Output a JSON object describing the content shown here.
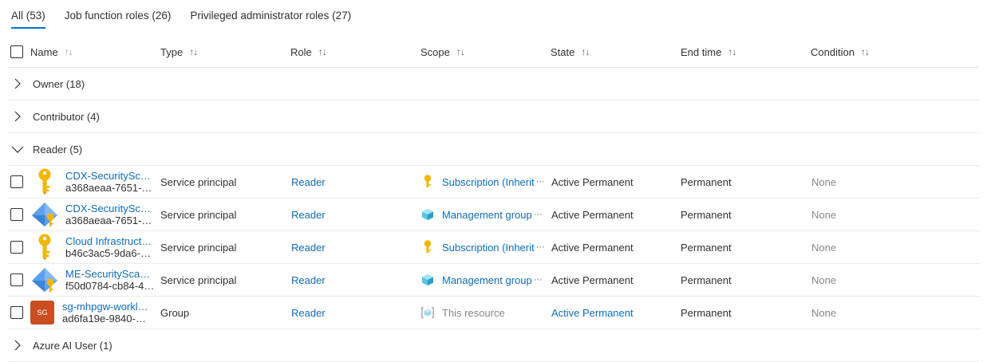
{
  "tabs": [
    {
      "label": "All (53)",
      "active": true
    },
    {
      "label": "Job function roles (26)",
      "active": false
    },
    {
      "label": "Privileged administrator roles (27)",
      "active": false
    }
  ],
  "columns": {
    "name": "Name",
    "type": "Type",
    "role": "Role",
    "scope": "Scope",
    "state": "State",
    "end_time": "End time",
    "condition": "Condition"
  },
  "groups": {
    "owner": "Owner (18)",
    "contributor": "Contributor (4)",
    "reader": "Reader (5)",
    "azure_ai_user": "Azure AI User (1)"
  },
  "rows": [
    {
      "icon": "key-icon",
      "name": "CDX-SecuritySca…",
      "id": "a368aeaa-7651-…",
      "type": "Service principal",
      "role": "Reader",
      "scope_icon": "key-icon",
      "scope": "Subscription (Inherit",
      "state": "Active Permanent",
      "end_time": "Permanent",
      "condition": "None"
    },
    {
      "icon": "managed-identity-icon",
      "name": "CDX-SecuritySca…",
      "id": "a368aeaa-7651-…",
      "type": "Service principal",
      "role": "Reader",
      "scope_icon": "cube-icon",
      "scope": "Management group",
      "state": "Active Permanent",
      "end_time": "Permanent",
      "condition": "None"
    },
    {
      "icon": "key-icon",
      "name": "Cloud Infrastruct…",
      "id": "b46c3ac5-9da6-…",
      "type": "Service principal",
      "role": "Reader",
      "scope_icon": "key-icon",
      "scope": "Subscription (Inherit",
      "state": "Active Permanent",
      "end_time": "Permanent",
      "condition": "None"
    },
    {
      "icon": "managed-identity-icon",
      "name": "ME-SecurityScan…",
      "id": "f50d0784-cb84-4…",
      "type": "Service principal",
      "role": "Reader",
      "scope_icon": "cube-icon",
      "scope": "Management group",
      "state": "Active Permanent",
      "end_time": "Permanent",
      "condition": "None"
    },
    {
      "icon": "group-avatar",
      "avatar_text": "SG",
      "name": "sg-mhpgw-workl…",
      "id": "ad6fa19e-9840-4c…",
      "type": "Group",
      "role": "Reader",
      "scope_icon": "resource-icon",
      "scope": "This resource",
      "state": "Active Permanent",
      "end_time": "Permanent",
      "condition": "None"
    }
  ],
  "colors": {
    "accent": "#0078d4",
    "link": "#0f6cbd",
    "muted": "#8a8886",
    "avatar_bg": "#c94f23"
  }
}
